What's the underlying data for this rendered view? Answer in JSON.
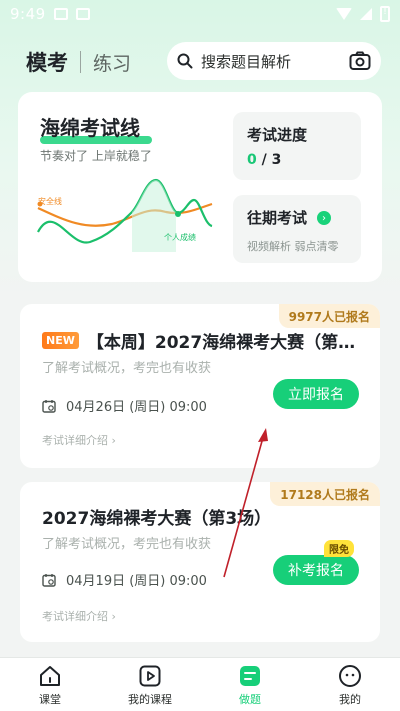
{
  "status_bar": {
    "time": "9:49"
  },
  "header": {
    "tabs": [
      {
        "label": "模考",
        "active": true
      },
      {
        "label": "练习",
        "active": false
      }
    ],
    "search": {
      "placeholder": "搜索题目解析"
    }
  },
  "promo": {
    "title": "海绵考试线",
    "subtitle": "节奏对了 上岸就稳了",
    "chart_legend": {
      "safe": "安全线",
      "personal": "个人成绩"
    },
    "progress_card": {
      "title": "考试进度",
      "done": "0",
      "total": "/ 3"
    },
    "history_card": {
      "title": "往期考试",
      "subtitle": "视频解析 弱点清零"
    }
  },
  "exams": [
    {
      "badge": "NEW",
      "title": "【本周】2027海绵裸考大赛（第…",
      "subtitle": "了解考试概况，考完也有收获",
      "date": "04月26日 (周日) 09:00",
      "registered": "9977人已报名",
      "button": "立即报名",
      "link": "考试详细介绍 ›"
    },
    {
      "title": "2027海绵裸考大赛（第3场）",
      "subtitle": "了解考试概况，考完也有收获",
      "date": "04月19日 (周日) 09:00",
      "registered": "17128人已报名",
      "button": "补考报名",
      "limit_badge": "限免",
      "link": "考试详细介绍 ›"
    }
  ],
  "bottom_nav": [
    {
      "label": "课堂",
      "icon": "home-icon"
    },
    {
      "label": "我的课程",
      "icon": "play-icon"
    },
    {
      "label": "做题",
      "icon": "exercise-icon",
      "active": true
    },
    {
      "label": "我的",
      "icon": "profile-icon"
    }
  ],
  "colors": {
    "accent": "#17cf79",
    "warning": "#f08a24",
    "badge_bg": "#fdf0d9"
  }
}
